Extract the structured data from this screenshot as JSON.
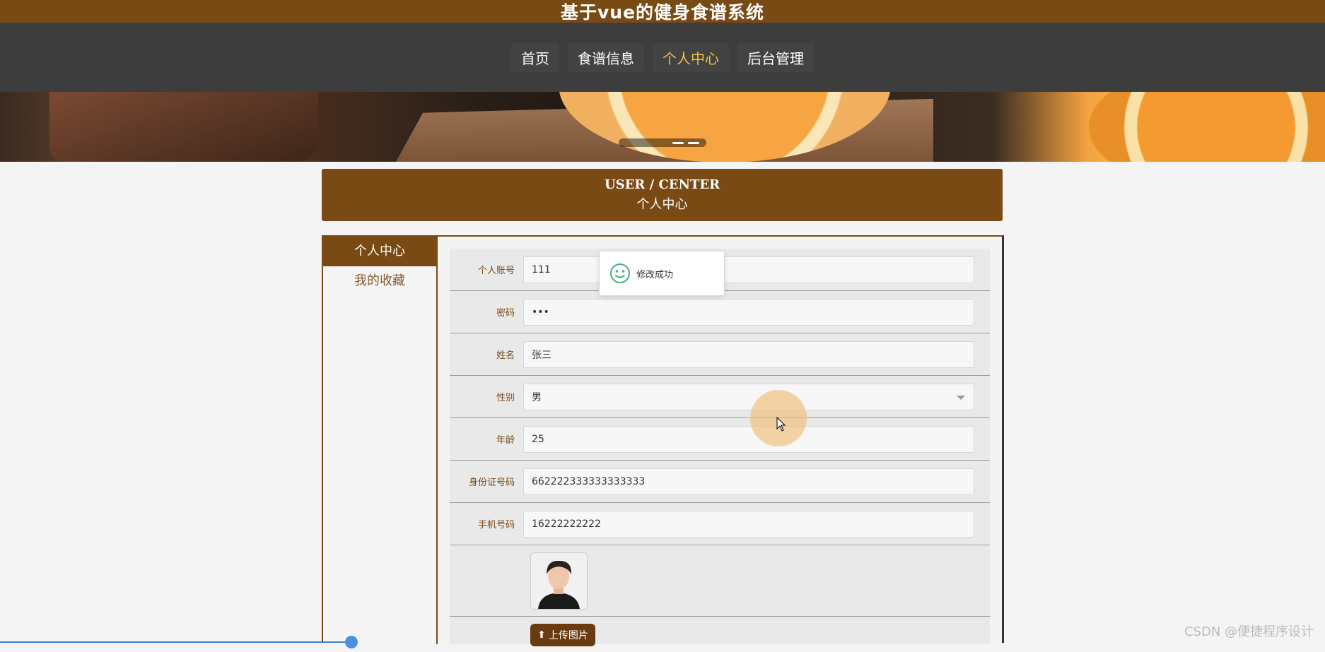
{
  "header": {
    "site_title": "基于vue的健身食谱系统"
  },
  "nav": {
    "items": [
      {
        "label": "首页",
        "active": false
      },
      {
        "label": "食谱信息",
        "active": false
      },
      {
        "label": "个人中心",
        "active": true
      },
      {
        "label": "后台管理",
        "active": false
      }
    ]
  },
  "section_header": {
    "en": "USER / CENTER",
    "cn": "个人中心"
  },
  "side_menu": {
    "items": [
      {
        "label": "个人中心",
        "active": true
      },
      {
        "label": "我的收藏",
        "active": false
      }
    ]
  },
  "form": {
    "account_label": "个人账号",
    "account_value": "111",
    "password_label": "密码",
    "password_value": "•••",
    "name_label": "姓名",
    "name_value": "张三",
    "gender_label": "性别",
    "gender_value": "男",
    "age_label": "年龄",
    "age_value": "25",
    "idcard_label": "身份证号码",
    "idcard_value": "662222333333333333",
    "phone_label": "手机号码",
    "phone_value": "16222222222",
    "upload_label": "上传图片"
  },
  "toast": {
    "message": "修改成功"
  },
  "watermark": "CSDN @便捷程序设计",
  "colors": {
    "brand_brown": "#7a4a15",
    "nav_bg": "#3d3d3d",
    "nav_active": "#f0c040"
  }
}
